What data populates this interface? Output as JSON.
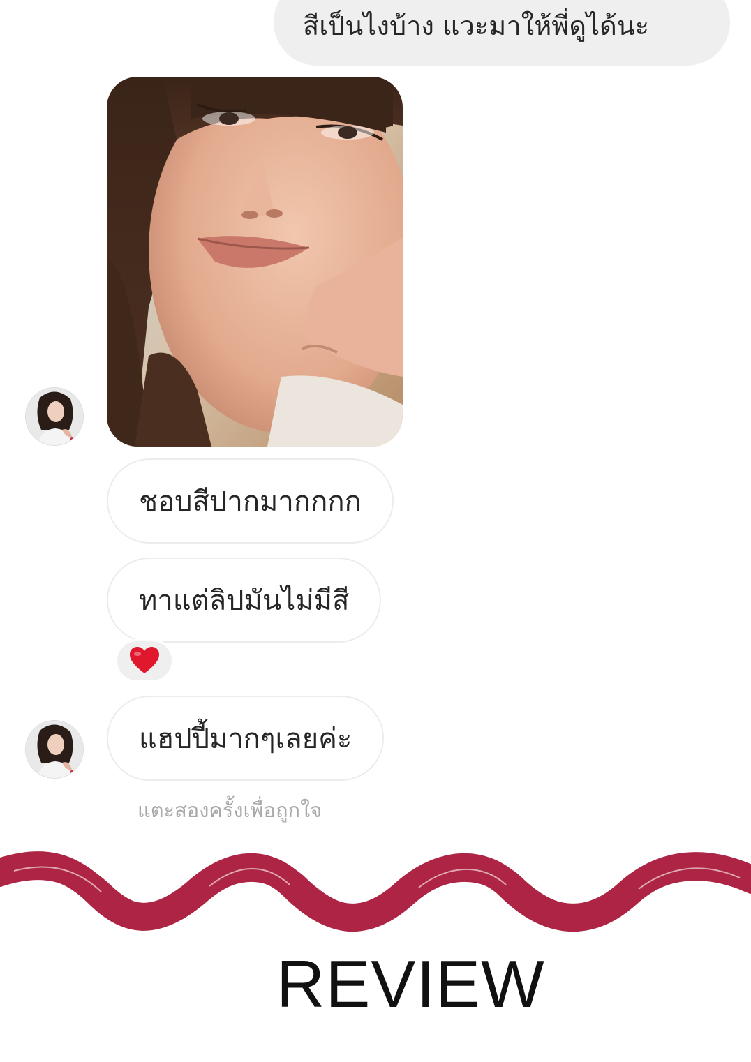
{
  "conversation": {
    "sent_message": "สีเป็นไงบ้าง แวะมาให้พี่ดูได้นะ",
    "photo": {
      "name": "selfie-photo"
    },
    "received_messages": [
      {
        "text": "ชอบสีปากมากกกก"
      },
      {
        "text": "ทาแต่ลิปมันไม่มีสี",
        "reaction": "heart-icon"
      },
      {
        "text": "แฮปปี้มากๆเลยค่ะ"
      }
    ],
    "double_tap_hint": "แตะสองครั้งเพื่อถูกใจ"
  },
  "banner": {
    "title": "REVIEW",
    "stroke_color": "#ad2444"
  },
  "colors": {
    "sent_bubble": "#efefef",
    "received_border": "#ececec",
    "hint_text": "#a8a8a8",
    "heart": "#e0182d"
  }
}
